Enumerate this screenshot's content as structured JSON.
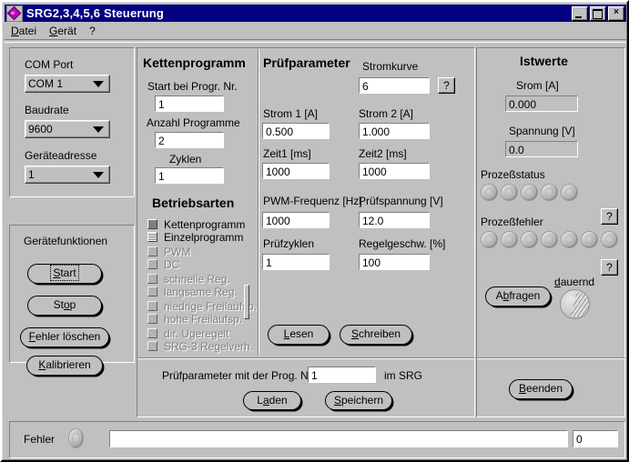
{
  "window": {
    "title": "SRG2,3,4,5,6 Steuerung",
    "icon": "app-icon",
    "minimize": "_",
    "maximize": "□",
    "close": "×"
  },
  "menu": {
    "items": [
      {
        "label": "Datei",
        "accel": "D"
      },
      {
        "label": "Gerät",
        "accel": "G"
      },
      {
        "label": "?",
        "accel": ""
      }
    ]
  },
  "connection": {
    "com_port_label": "COM Port",
    "com_port_value": "COM 1",
    "baudrate_label": "Baudrate",
    "baudrate_value": "9600",
    "address_label": "Geräteadresse",
    "address_value": "1"
  },
  "device_functions": {
    "title": "Gerätefunktionen",
    "start": "Start",
    "stop": "Stop",
    "clear_errors": "Fehler löschen",
    "calibrate": "Kalibrieren"
  },
  "chain_program": {
    "title": "Kettenprogramm",
    "start_prog_label": "Start bei Progr. Nr.",
    "start_prog_value": "1",
    "count_label": "Anzahl Programme",
    "count_value": "2",
    "cycles_label": "Zyklen",
    "cycles_value": "1"
  },
  "modes": {
    "title": "Betriebsarten",
    "items": [
      {
        "label": "Kettenprogramm",
        "state": "on",
        "disabled": false
      },
      {
        "label": "Einzelprogramm",
        "state": "off",
        "disabled": false
      },
      {
        "label": "PWM",
        "state": "dis",
        "disabled": true
      },
      {
        "label": "DC",
        "state": "dis",
        "disabled": true
      },
      {
        "label": "schnelle Reg.",
        "state": "dis",
        "disabled": true
      },
      {
        "label": "langsame Reg.",
        "state": "dis",
        "disabled": true
      },
      {
        "label": "niedrige Freilaufsp.",
        "state": "dis",
        "disabled": true
      },
      {
        "label": "hohe Freilaufsp.",
        "state": "dis",
        "disabled": true
      },
      {
        "label": "dir. Ugeregelt",
        "state": "dis",
        "disabled": true
      },
      {
        "label": "SRG-3 Regelverh.",
        "state": "dis",
        "disabled": true
      }
    ]
  },
  "test_params": {
    "title": "Prüfparameter",
    "stromkurve_label": "Stromkurve",
    "stromkurve_value": "6",
    "stromkurve_help": "?",
    "strom1_label": "Strom 1 [A]",
    "strom1_value": "0.500",
    "strom2_label": "Strom 2 [A]",
    "strom2_value": "1.000",
    "zeit1_label": "Zeit1 [ms]",
    "zeit1_value": "1000",
    "zeit2_label": "Zeit2 [ms]",
    "zeit2_value": "1000",
    "pwm_label": "PWM-Frequenz [Hz]",
    "pwm_value": "1000",
    "pruefspannung_label": "Prüfspannung [V]",
    "pruefspannung_value": "12.0",
    "pruefzyklen_label": "Prüfzyklen",
    "pruefzyklen_value": "1",
    "regelgeschw_label": "Regelgeschw. [%]",
    "regelgeschw_value": "100",
    "read_button": "Lesen",
    "write_button": "Schreiben"
  },
  "program_store": {
    "prefix_label": "Prüfparameter mit der Prog. Nr.",
    "prog_nr_value": "1",
    "suffix_label": "im SRG",
    "load_button": "Laden",
    "save_button": "Speichern"
  },
  "actual_values": {
    "title": "Istwerte",
    "current_label": "Srom [A]",
    "current_value": "0.000",
    "voltage_label": "Spannung [V]",
    "voltage_value": "0.0",
    "status_label": "Prozeßstatus",
    "status_leds": 5,
    "status_help": "?",
    "error_label": "Prozeßfehler",
    "error_leds": 7,
    "error_help": "?",
    "query_button": "Abfragen",
    "continuous_label": "dauernd"
  },
  "exit": {
    "button": "Beenden"
  },
  "statusbar": {
    "error_label": "Fehler",
    "message": "",
    "error_count": "0"
  },
  "colors": {
    "face": "#c0c0c0",
    "titlebar": "#000080",
    "field": "#ffffff",
    "shadow": "#808080",
    "text": "#000000"
  }
}
